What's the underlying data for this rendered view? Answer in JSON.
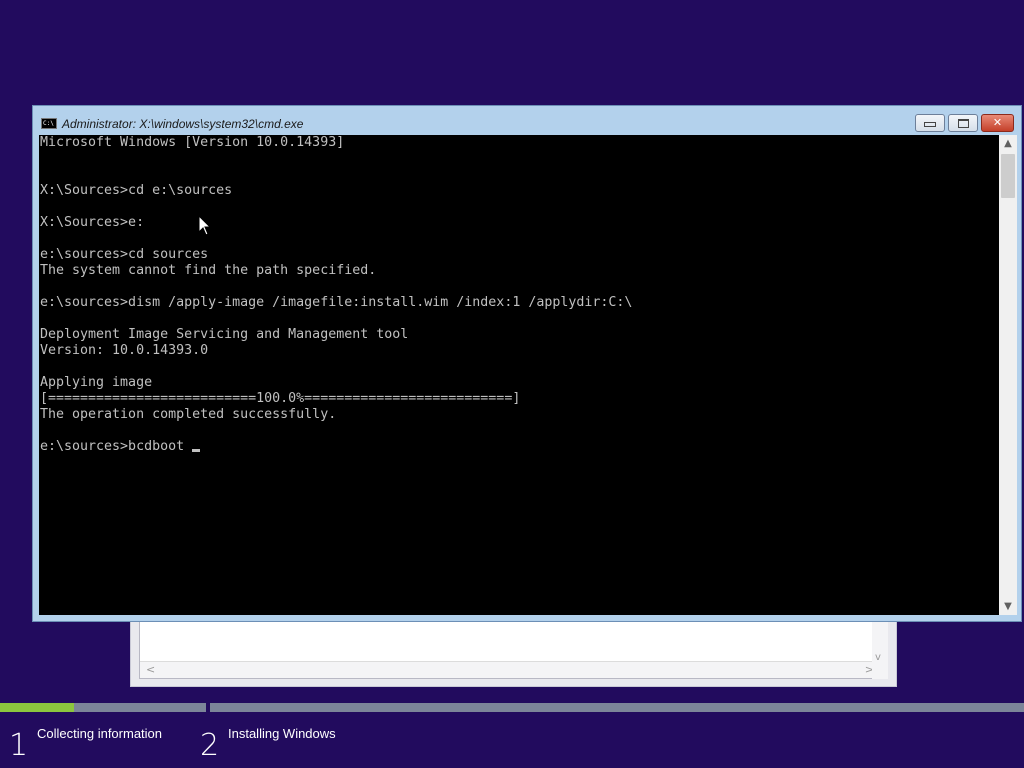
{
  "colors": {
    "desktop_background": "#220b5e",
    "console_background": "#000000",
    "console_text": "#c0c0c0",
    "progress_done": "#8cc63e",
    "progress_pending": "#7c8599",
    "title_bar": "#b3d1ec"
  },
  "cmd_window": {
    "title": "Administrator: X:\\windows\\system32\\cmd.exe",
    "icon": "cmd-icon",
    "icon_text": "C:\\",
    "buttons": {
      "minimize": "minimize-icon",
      "maximize": "maximize-icon",
      "close": "close-icon",
      "close_glyph": "✕"
    },
    "console_lines": [
      "Microsoft Windows [Version 10.0.14393]",
      "",
      "",
      "X:\\Sources>cd e:\\sources",
      "",
      "X:\\Sources>e:",
      "",
      "e:\\sources>cd sources",
      "The system cannot find the path specified.",
      "",
      "e:\\sources>dism /apply-image /imagefile:install.wim /index:1 /applydir:C:\\",
      "",
      "Deployment Image Servicing and Management tool",
      "Version: 10.0.14393.0",
      "",
      "Applying image",
      "[==========================100.0%==========================]",
      "The operation completed successfully.",
      "",
      "e:\\sources>bcdboot "
    ],
    "scrollbar": {
      "up_arrow": "▲",
      "down_arrow": "▼"
    }
  },
  "setup_steps": {
    "progress_fraction_step1": 0.36,
    "steps": [
      {
        "number": "1",
        "label": "Collecting information"
      },
      {
        "number": "2",
        "label": "Installing Windows"
      }
    ]
  },
  "background_window": {
    "left_arrow": "<",
    "right_arrow": ">",
    "down_arrow": "v"
  }
}
